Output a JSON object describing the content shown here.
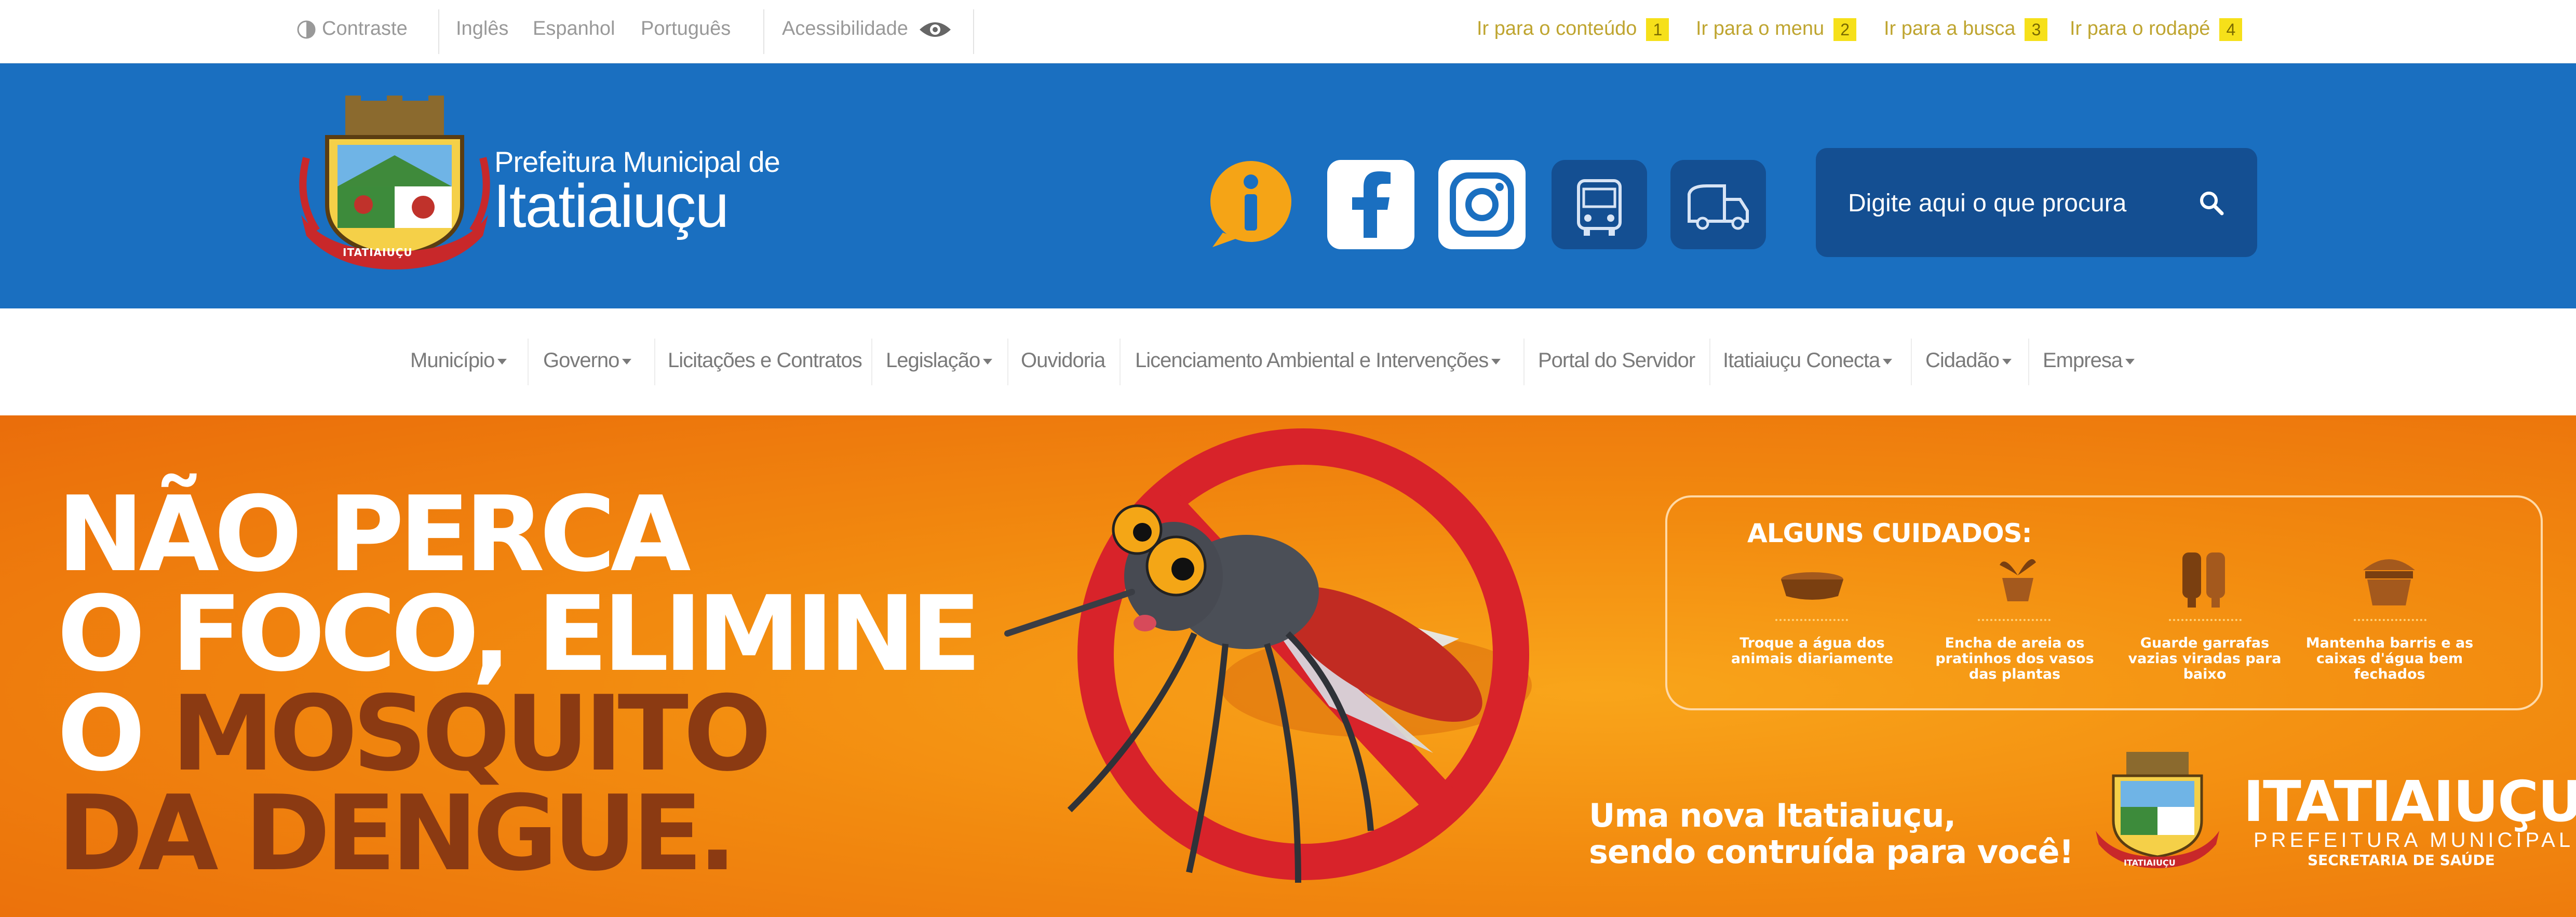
{
  "topbar": {
    "contrast_label": "Contraste",
    "languages": [
      "Inglês",
      "Espanhol",
      "Português"
    ],
    "accessibility_label": "Acessibilidade",
    "skip_links": [
      {
        "label": "Ir para o conteúdo",
        "key": "1"
      },
      {
        "label": "Ir para o menu",
        "key": "2"
      },
      {
        "label": "Ir para a busca",
        "key": "3"
      },
      {
        "label": "Ir para o rodapé",
        "key": "4"
      }
    ]
  },
  "header": {
    "logo_line1": "Prefeitura Municipal de",
    "logo_line2": "Itatiaiuçu",
    "crest_ribbon": "ITATIAIUÇU",
    "social_icons": [
      "info-icon",
      "facebook-icon",
      "instagram-icon",
      "bus-icon",
      "truck-icon"
    ],
    "search_placeholder": "Digite aqui o que procura"
  },
  "nav": {
    "items": [
      {
        "label": "Município",
        "dropdown": true
      },
      {
        "label": "Governo",
        "dropdown": true
      },
      {
        "label": "Licitações e Contratos",
        "dropdown": false
      },
      {
        "label": "Legislação",
        "dropdown": true
      },
      {
        "label": "Ouvidoria",
        "dropdown": false
      },
      {
        "label": "Licenciamento Ambiental e Intervenções",
        "dropdown": true
      },
      {
        "label": "Portal do Servidor",
        "dropdown": false
      },
      {
        "label": "Itatiaiuçu Conecta",
        "dropdown": true
      },
      {
        "label": "Cidadão",
        "dropdown": true
      },
      {
        "label": "Empresa",
        "dropdown": true
      }
    ]
  },
  "banner": {
    "headline": [
      "NÃO PERCA",
      "O FOCO, ELIMINE",
      "O MOSQUITO",
      "DA DENGUE."
    ],
    "cares_title": "ALGUNS CUIDADOS:",
    "cares": [
      {
        "text": "Troque a água dos animais diariamente",
        "icon": "water-bowl-icon"
      },
      {
        "text": "Encha de areia os pratinhos dos vasos das plantas",
        "icon": "plant-pot-icon"
      },
      {
        "text": "Guarde garrafas vazias viradas para baixo",
        "icon": "bottles-icon"
      },
      {
        "text": "Mantenha barris e as caixas d'água bem fechados",
        "icon": "barrel-icon"
      }
    ],
    "slogan": [
      "Uma nova Itatiaiuçu,",
      "sendo contruída para você!"
    ],
    "brand_name": "ITATIAIUÇU",
    "brand_subtitle": "PREFEITURA MUNICIPAL",
    "brand_department": "SECRETARIA DE SAÚDE",
    "brand_crest_ribbon": "ITATIAIUÇU"
  },
  "colors": {
    "header_blue": "#1a6fc0",
    "search_blue": "#144f92",
    "banner_orange": "#f28a0f",
    "headline_brown": "#8b3a12",
    "skip_key_yellow": "#f6e01a"
  }
}
